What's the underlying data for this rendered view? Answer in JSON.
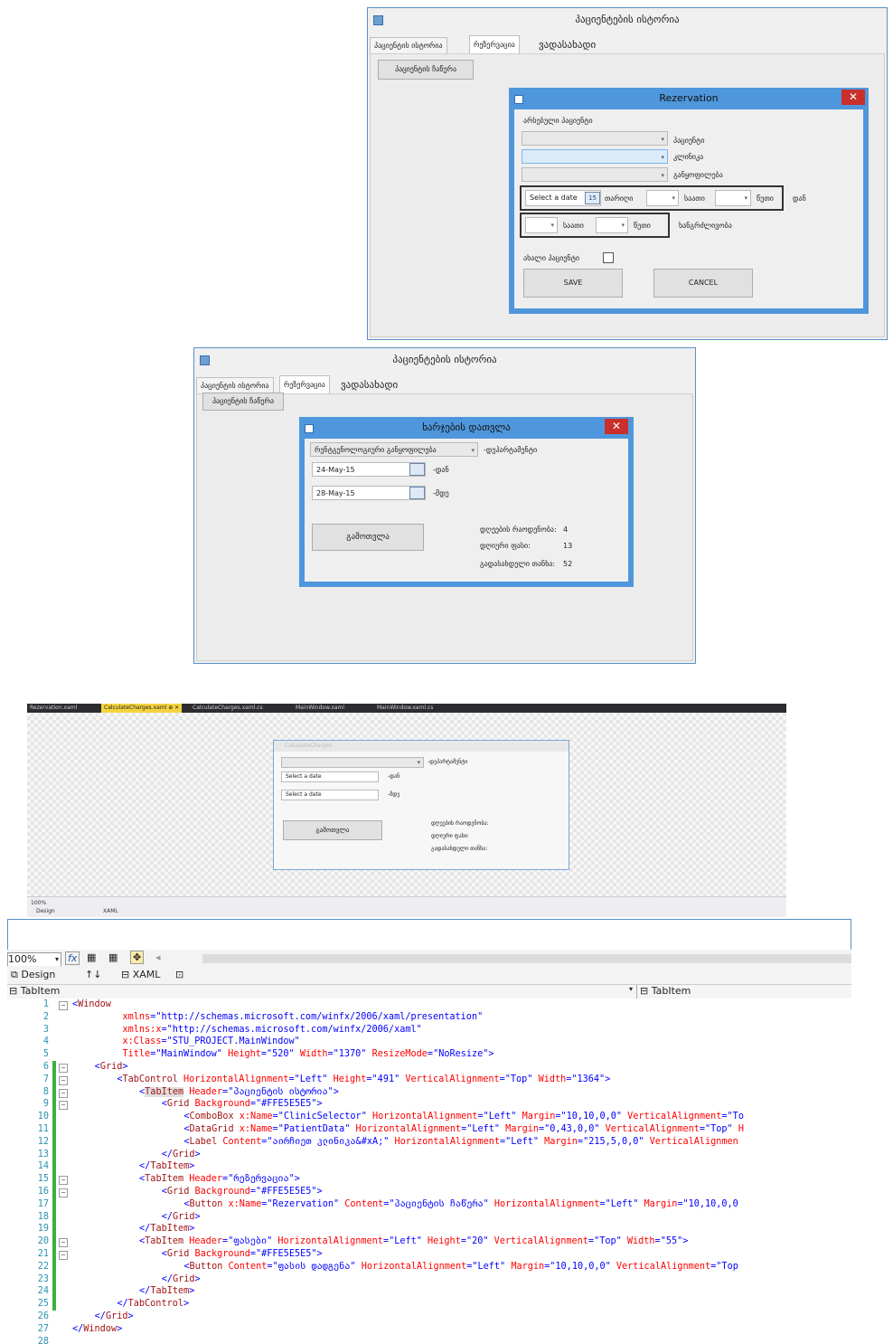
{
  "window1": {
    "title": "პაციენტების ისტორია",
    "tabs": [
      "პაციენტის ისტორია",
      "რეზერვაცია",
      "ვადასახადი"
    ],
    "main_button": "პაციენტის ჩაწერა",
    "dialog": {
      "title": "Rezervation",
      "close": "✕",
      "section_label": "არსებული პაციენტი",
      "field_labels": [
        "პაციენტი",
        "კლინიკა",
        "განყოფილება"
      ],
      "date_placeholder": "Select a date",
      "cal_glyph": "15",
      "date_row_labels": [
        "თარიღი",
        "საათი",
        "წუთი"
      ],
      "from_label": "დან",
      "duration_labels": [
        "საათი",
        "წუთი"
      ],
      "duration_label": "ხანგრძლივობა",
      "new_patient_label": "ახალი პაციენტი",
      "save": "SAVE",
      "cancel": "CANCEL"
    }
  },
  "window2": {
    "title": "პაციენტების ისტორია",
    "tabs": [
      "პაციენტის ისტორია",
      "რეზერვაცია",
      "ვადასახადი"
    ],
    "main_button": "პაციენტის ჩაწერა",
    "dialog": {
      "title": "ხარჯების დათვლა",
      "close": "✕",
      "combo_value": "რენტგენოლოგიური განყოფილება",
      "combo_label": "-დეპარტამენტი",
      "date_from": "24-May-15",
      "date_from_label": "-დან",
      "date_to": "28-May-15",
      "date_to_label": "-მდე",
      "calc_button": "გამოთვლა",
      "stats": [
        {
          "label": "დღეების რაოდენობა:",
          "value": "4"
        },
        {
          "label": "დღიური ფასი:",
          "value": "13"
        },
        {
          "label": "გადასახდელი თანხა:",
          "value": "52"
        }
      ]
    }
  },
  "designer": {
    "doc_tabs": [
      "Rezervation.xaml",
      "CalculateCharges.xaml",
      "CalculateCharges.xaml.cs",
      "MainWindow.xaml",
      "MainWindow.xaml.cs"
    ],
    "active_tab_suffix": "⊕ ✕",
    "preview": {
      "title": "CalculateCharges",
      "combo_label": "-დეპარტამენტი",
      "date_placeholder": "Select a date",
      "date_from_label": "-დან",
      "date_to_label": "-მდე",
      "calc_button": "გამოთვლა",
      "stats": [
        "დღეების რაოდენობა:",
        "დღიური ფასი:",
        "გადასახდელი თანხა:"
      ]
    },
    "status": {
      "zoom": "100%",
      "design": "Design",
      "xaml": "XAML"
    }
  },
  "editor": {
    "zoom": "100%",
    "fx": "fx",
    "design_tab": "Design",
    "sort_glyph": "↑↓",
    "xaml_tab": "XAML",
    "left_crumb": "TabItem",
    "right_crumb": "TabItem",
    "lines": [
      {
        "n": "1",
        "indent": 0,
        "segs": [
          [
            "pun",
            "<"
          ],
          [
            "tag",
            "Window"
          ]
        ]
      },
      {
        "n": "2",
        "indent": 9,
        "segs": [
          [
            "attr",
            "xmlns"
          ],
          [
            "pun",
            "="
          ],
          [
            "val",
            "\"http://schemas.microsoft.com/winfx/2006/xaml/presentation\""
          ]
        ]
      },
      {
        "n": "3",
        "indent": 9,
        "segs": [
          [
            "attr",
            "xmlns:x"
          ],
          [
            "pun",
            "="
          ],
          [
            "val",
            "\"http://schemas.microsoft.com/winfx/2006/xaml\""
          ]
        ]
      },
      {
        "n": "4",
        "indent": 9,
        "segs": [
          [
            "attr",
            "x:Class"
          ],
          [
            "pun",
            "="
          ],
          [
            "val",
            "\"STU_PROJECT.MainWindow\""
          ]
        ]
      },
      {
        "n": "5",
        "indent": 9,
        "segs": [
          [
            "attr",
            "Title"
          ],
          [
            "pun",
            "="
          ],
          [
            "val",
            "\"MainWindow\""
          ],
          [
            "attr",
            " Height"
          ],
          [
            "pun",
            "="
          ],
          [
            "val",
            "\"520\""
          ],
          [
            "attr",
            " Width"
          ],
          [
            "pun",
            "="
          ],
          [
            "val",
            "\"1370\""
          ],
          [
            "attr",
            " ResizeMode"
          ],
          [
            "pun",
            "="
          ],
          [
            "val",
            "\"NoResize\""
          ],
          [
            "pun",
            ">"
          ]
        ]
      },
      {
        "n": "6",
        "indent": 4,
        "segs": [
          [
            "pun",
            "<"
          ],
          [
            "tag",
            "Grid"
          ],
          [
            "pun",
            ">"
          ]
        ]
      },
      {
        "n": "7",
        "indent": 8,
        "segs": [
          [
            "pun",
            "<"
          ],
          [
            "tag",
            "TabControl"
          ],
          [
            "attr",
            " HorizontalAlignment"
          ],
          [
            "pun",
            "="
          ],
          [
            "val",
            "\"Left\""
          ],
          [
            "attr",
            " Height"
          ],
          [
            "pun",
            "="
          ],
          [
            "val",
            "\"491\""
          ],
          [
            "attr",
            " VerticalAlignment"
          ],
          [
            "pun",
            "="
          ],
          [
            "val",
            "\"Top\""
          ],
          [
            "attr",
            " Width"
          ],
          [
            "pun",
            "="
          ],
          [
            "val",
            "\"1364\""
          ],
          [
            "pun",
            ">"
          ]
        ]
      },
      {
        "n": "8",
        "indent": 12,
        "segs": [
          [
            "pun",
            "<"
          ],
          [
            "hl",
            "TabItem"
          ],
          [
            "attr",
            " Header"
          ],
          [
            "pun",
            "="
          ],
          [
            "val",
            "\"პაციენტის ისტორია\""
          ],
          [
            "pun",
            ">"
          ]
        ]
      },
      {
        "n": "9",
        "indent": 16,
        "segs": [
          [
            "pun",
            "<"
          ],
          [
            "tag",
            "Grid"
          ],
          [
            "attr",
            " Background"
          ],
          [
            "pun",
            "="
          ],
          [
            "val",
            "\"#FFE5E5E5\""
          ],
          [
            "pun",
            ">"
          ]
        ]
      },
      {
        "n": "10",
        "indent": 20,
        "segs": [
          [
            "pun",
            "<"
          ],
          [
            "tag",
            "ComboBox"
          ],
          [
            "attr",
            " x:Name"
          ],
          [
            "pun",
            "="
          ],
          [
            "val",
            "\"ClinicSelector\""
          ],
          [
            "attr",
            " HorizontalAlignment"
          ],
          [
            "pun",
            "="
          ],
          [
            "val",
            "\"Left\""
          ],
          [
            "attr",
            " Margin"
          ],
          [
            "pun",
            "="
          ],
          [
            "val",
            "\"10,10,0,0\""
          ],
          [
            "attr",
            " VerticalAlignment"
          ],
          [
            "pun",
            "="
          ],
          [
            "val",
            "\"To"
          ]
        ]
      },
      {
        "n": "11",
        "indent": 20,
        "segs": [
          [
            "pun",
            "<"
          ],
          [
            "tag",
            "DataGrid"
          ],
          [
            "attr",
            " x:Name"
          ],
          [
            "pun",
            "="
          ],
          [
            "val",
            "\"PatientData\""
          ],
          [
            "attr",
            " HorizontalAlignment"
          ],
          [
            "pun",
            "="
          ],
          [
            "val",
            "\"Left\""
          ],
          [
            "attr",
            " Margin"
          ],
          [
            "pun",
            "="
          ],
          [
            "val",
            "\"0,43,0,0\""
          ],
          [
            "attr",
            " VerticalAlignment"
          ],
          [
            "pun",
            "="
          ],
          [
            "val",
            "\"Top\""
          ],
          [
            "attr",
            " H"
          ]
        ]
      },
      {
        "n": "12",
        "indent": 20,
        "segs": [
          [
            "pun",
            "<"
          ],
          [
            "tag",
            "Label"
          ],
          [
            "attr",
            " Content"
          ],
          [
            "pun",
            "="
          ],
          [
            "val",
            "\"აირჩიეთ კლინიკა&#xA;\""
          ],
          [
            "attr",
            " HorizontalAlignment"
          ],
          [
            "pun",
            "="
          ],
          [
            "val",
            "\"Left\""
          ],
          [
            "attr",
            " Margin"
          ],
          [
            "pun",
            "="
          ],
          [
            "val",
            "\"215,5,0,0\""
          ],
          [
            "attr",
            " VerticalAlignmen"
          ]
        ]
      },
      {
        "n": "13",
        "indent": 16,
        "segs": [
          [
            "pun",
            "</"
          ],
          [
            "tag",
            "Grid"
          ],
          [
            "pun",
            ">"
          ]
        ]
      },
      {
        "n": "14",
        "indent": 12,
        "segs": [
          [
            "pun",
            "</"
          ],
          [
            "tag",
            "TabItem"
          ],
          [
            "pun",
            ">"
          ]
        ]
      },
      {
        "n": "15",
        "indent": 12,
        "segs": [
          [
            "pun",
            "<"
          ],
          [
            "tag",
            "TabItem"
          ],
          [
            "attr",
            " Header"
          ],
          [
            "pun",
            "="
          ],
          [
            "val",
            "\"რეზერვაცია\""
          ],
          [
            "pun",
            ">"
          ]
        ]
      },
      {
        "n": "16",
        "indent": 16,
        "segs": [
          [
            "pun",
            "<"
          ],
          [
            "tag",
            "Grid"
          ],
          [
            "attr",
            " Background"
          ],
          [
            "pun",
            "="
          ],
          [
            "val",
            "\"#FFE5E5E5\""
          ],
          [
            "pun",
            ">"
          ]
        ]
      },
      {
        "n": "17",
        "indent": 20,
        "segs": [
          [
            "pun",
            "<"
          ],
          [
            "tag",
            "Button"
          ],
          [
            "attr",
            " x:Name"
          ],
          [
            "pun",
            "="
          ],
          [
            "val",
            "\"Rezervation\""
          ],
          [
            "attr",
            " Content"
          ],
          [
            "pun",
            "="
          ],
          [
            "val",
            "\"პაციენტის ჩაწერა\""
          ],
          [
            "attr",
            " HorizontalAlignment"
          ],
          [
            "pun",
            "="
          ],
          [
            "val",
            "\"Left\""
          ],
          [
            "attr",
            " Margin"
          ],
          [
            "pun",
            "="
          ],
          [
            "val",
            "\"10,10,0,0"
          ]
        ]
      },
      {
        "n": "18",
        "indent": 16,
        "segs": [
          [
            "pun",
            "</"
          ],
          [
            "tag",
            "Grid"
          ],
          [
            "pun",
            ">"
          ]
        ]
      },
      {
        "n": "19",
        "indent": 12,
        "segs": [
          [
            "pun",
            "</"
          ],
          [
            "tag",
            "TabItem"
          ],
          [
            "pun",
            ">"
          ]
        ]
      },
      {
        "n": "20",
        "indent": 12,
        "segs": [
          [
            "pun",
            "<"
          ],
          [
            "tag",
            "TabItem"
          ],
          [
            "attr",
            " Header"
          ],
          [
            "pun",
            "="
          ],
          [
            "val",
            "\"ფასები\""
          ],
          [
            "attr",
            " HorizontalAlignment"
          ],
          [
            "pun",
            "="
          ],
          [
            "val",
            "\"Left\""
          ],
          [
            "attr",
            " Height"
          ],
          [
            "pun",
            "="
          ],
          [
            "val",
            "\"20\""
          ],
          [
            "attr",
            " VerticalAlignment"
          ],
          [
            "pun",
            "="
          ],
          [
            "val",
            "\"Top\""
          ],
          [
            "attr",
            " Width"
          ],
          [
            "pun",
            "="
          ],
          [
            "val",
            "\"55\""
          ],
          [
            "pun",
            ">"
          ]
        ]
      },
      {
        "n": "21",
        "indent": 16,
        "segs": [
          [
            "pun",
            "<"
          ],
          [
            "tag",
            "Grid"
          ],
          [
            "attr",
            " Background"
          ],
          [
            "pun",
            "="
          ],
          [
            "val",
            "\"#FFE5E5E5\""
          ],
          [
            "pun",
            ">"
          ]
        ]
      },
      {
        "n": "22",
        "indent": 20,
        "segs": [
          [
            "pun",
            "<"
          ],
          [
            "tag",
            "Button"
          ],
          [
            "attr",
            " Content"
          ],
          [
            "pun",
            "="
          ],
          [
            "val",
            "\"ფასის დადგენა\""
          ],
          [
            "attr",
            " HorizontalAlignment"
          ],
          [
            "pun",
            "="
          ],
          [
            "val",
            "\"Left\""
          ],
          [
            "attr",
            " Margin"
          ],
          [
            "pun",
            "="
          ],
          [
            "val",
            "\"10,10,0,0\""
          ],
          [
            "attr",
            " VerticalAlignment"
          ],
          [
            "pun",
            "="
          ],
          [
            "val",
            "\"Top"
          ]
        ]
      },
      {
        "n": "23",
        "indent": 16,
        "segs": [
          [
            "pun",
            "</"
          ],
          [
            "tag",
            "Grid"
          ],
          [
            "pun",
            ">"
          ]
        ]
      },
      {
        "n": "24",
        "indent": 12,
        "segs": [
          [
            "pun",
            "</"
          ],
          [
            "tag",
            "TabItem"
          ],
          [
            "pun",
            ">"
          ]
        ]
      },
      {
        "n": "25",
        "indent": 8,
        "segs": [
          [
            "pun",
            "</"
          ],
          [
            "tag",
            "TabControl"
          ],
          [
            "pun",
            ">"
          ]
        ]
      },
      {
        "n": "26",
        "indent": 4,
        "segs": [
          [
            "pun",
            "</"
          ],
          [
            "tag",
            "Grid"
          ],
          [
            "pun",
            ">"
          ]
        ]
      },
      {
        "n": "27",
        "indent": 0,
        "segs": [
          [
            "pun",
            "</"
          ],
          [
            "tag",
            "Window"
          ],
          [
            "pun",
            ">"
          ]
        ]
      },
      {
        "n": "28",
        "indent": 0,
        "segs": []
      }
    ]
  }
}
